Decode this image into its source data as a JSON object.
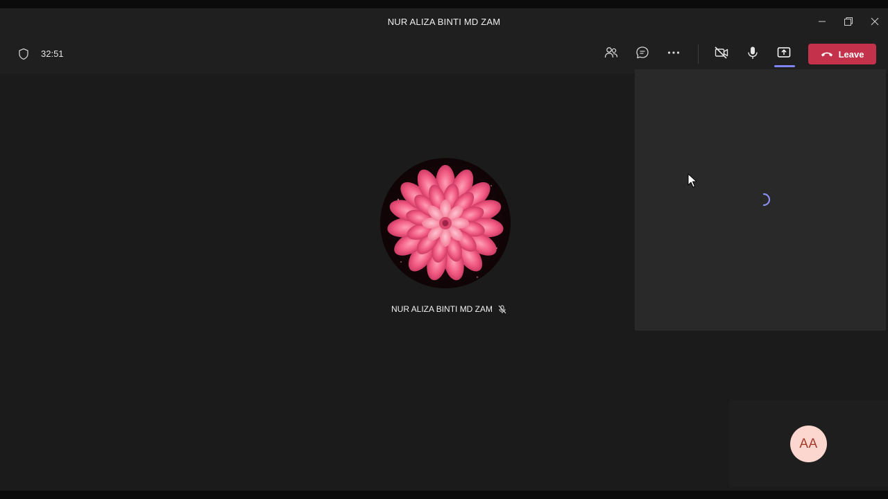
{
  "window": {
    "title": "NUR ALIZA BINTI MD ZAM",
    "controls": [
      "minimize-icon",
      "restore-icon",
      "close-icon"
    ]
  },
  "toolbar": {
    "timer": "32:51",
    "icons": [
      "shield-icon",
      "participants-icon",
      "chat-icon",
      "more-options-icon",
      "camera-off-icon",
      "microphone-icon",
      "share-screen-icon"
    ],
    "leave_label": "Leave"
  },
  "stage": {
    "participant": {
      "name": "NUR ALIZA BINTI MD ZAM",
      "muted_icon": "mic-off-icon"
    }
  },
  "self_view": {
    "initials": "AA"
  },
  "colors": {
    "leave": "#c4314b",
    "accent": "#7f85f5",
    "avatar_bg": "#fcd7cf",
    "avatar_text": "#a33b2a"
  }
}
